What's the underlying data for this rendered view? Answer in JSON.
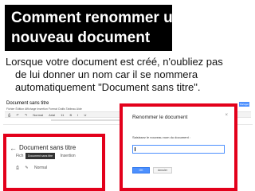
{
  "slide": {
    "title_line1": "Comment renommer un",
    "title_line2": "nouveau document",
    "intro_line1": "Lorsque votre document est créé, n'oubliez pas",
    "intro_line2": "de lui donner un nom car il se nommera",
    "intro_line3": "automatiquement \"Document sans titre\"."
  },
  "docs_screenshot": {
    "doc_title": "Document sans titre",
    "menu": "Fichier  Édition  Affichage  Insertion  Format  Outils  Tableau  Aide",
    "toolbar_style": "Normal",
    "toolbar_font": "Arial",
    "toolbar_size": "11",
    "share_label": "Partager"
  },
  "left_crop": {
    "back_icon": "arrow-left-icon",
    "doc_title": "Document sans titre",
    "menu_fichier": "Fich",
    "menu_insertion": "Insertion",
    "tooltip": "Document sans titre",
    "toolbar_style": "Normal"
  },
  "rename_dialog": {
    "title": "Renommer le document",
    "label": "Saisissez le nouveau nom du document :",
    "input_value": "",
    "ok_label": "OK",
    "cancel_label": "Annuler"
  },
  "colors": {
    "frame_red": "#e3001b",
    "button_blue": "#4d90fe"
  }
}
